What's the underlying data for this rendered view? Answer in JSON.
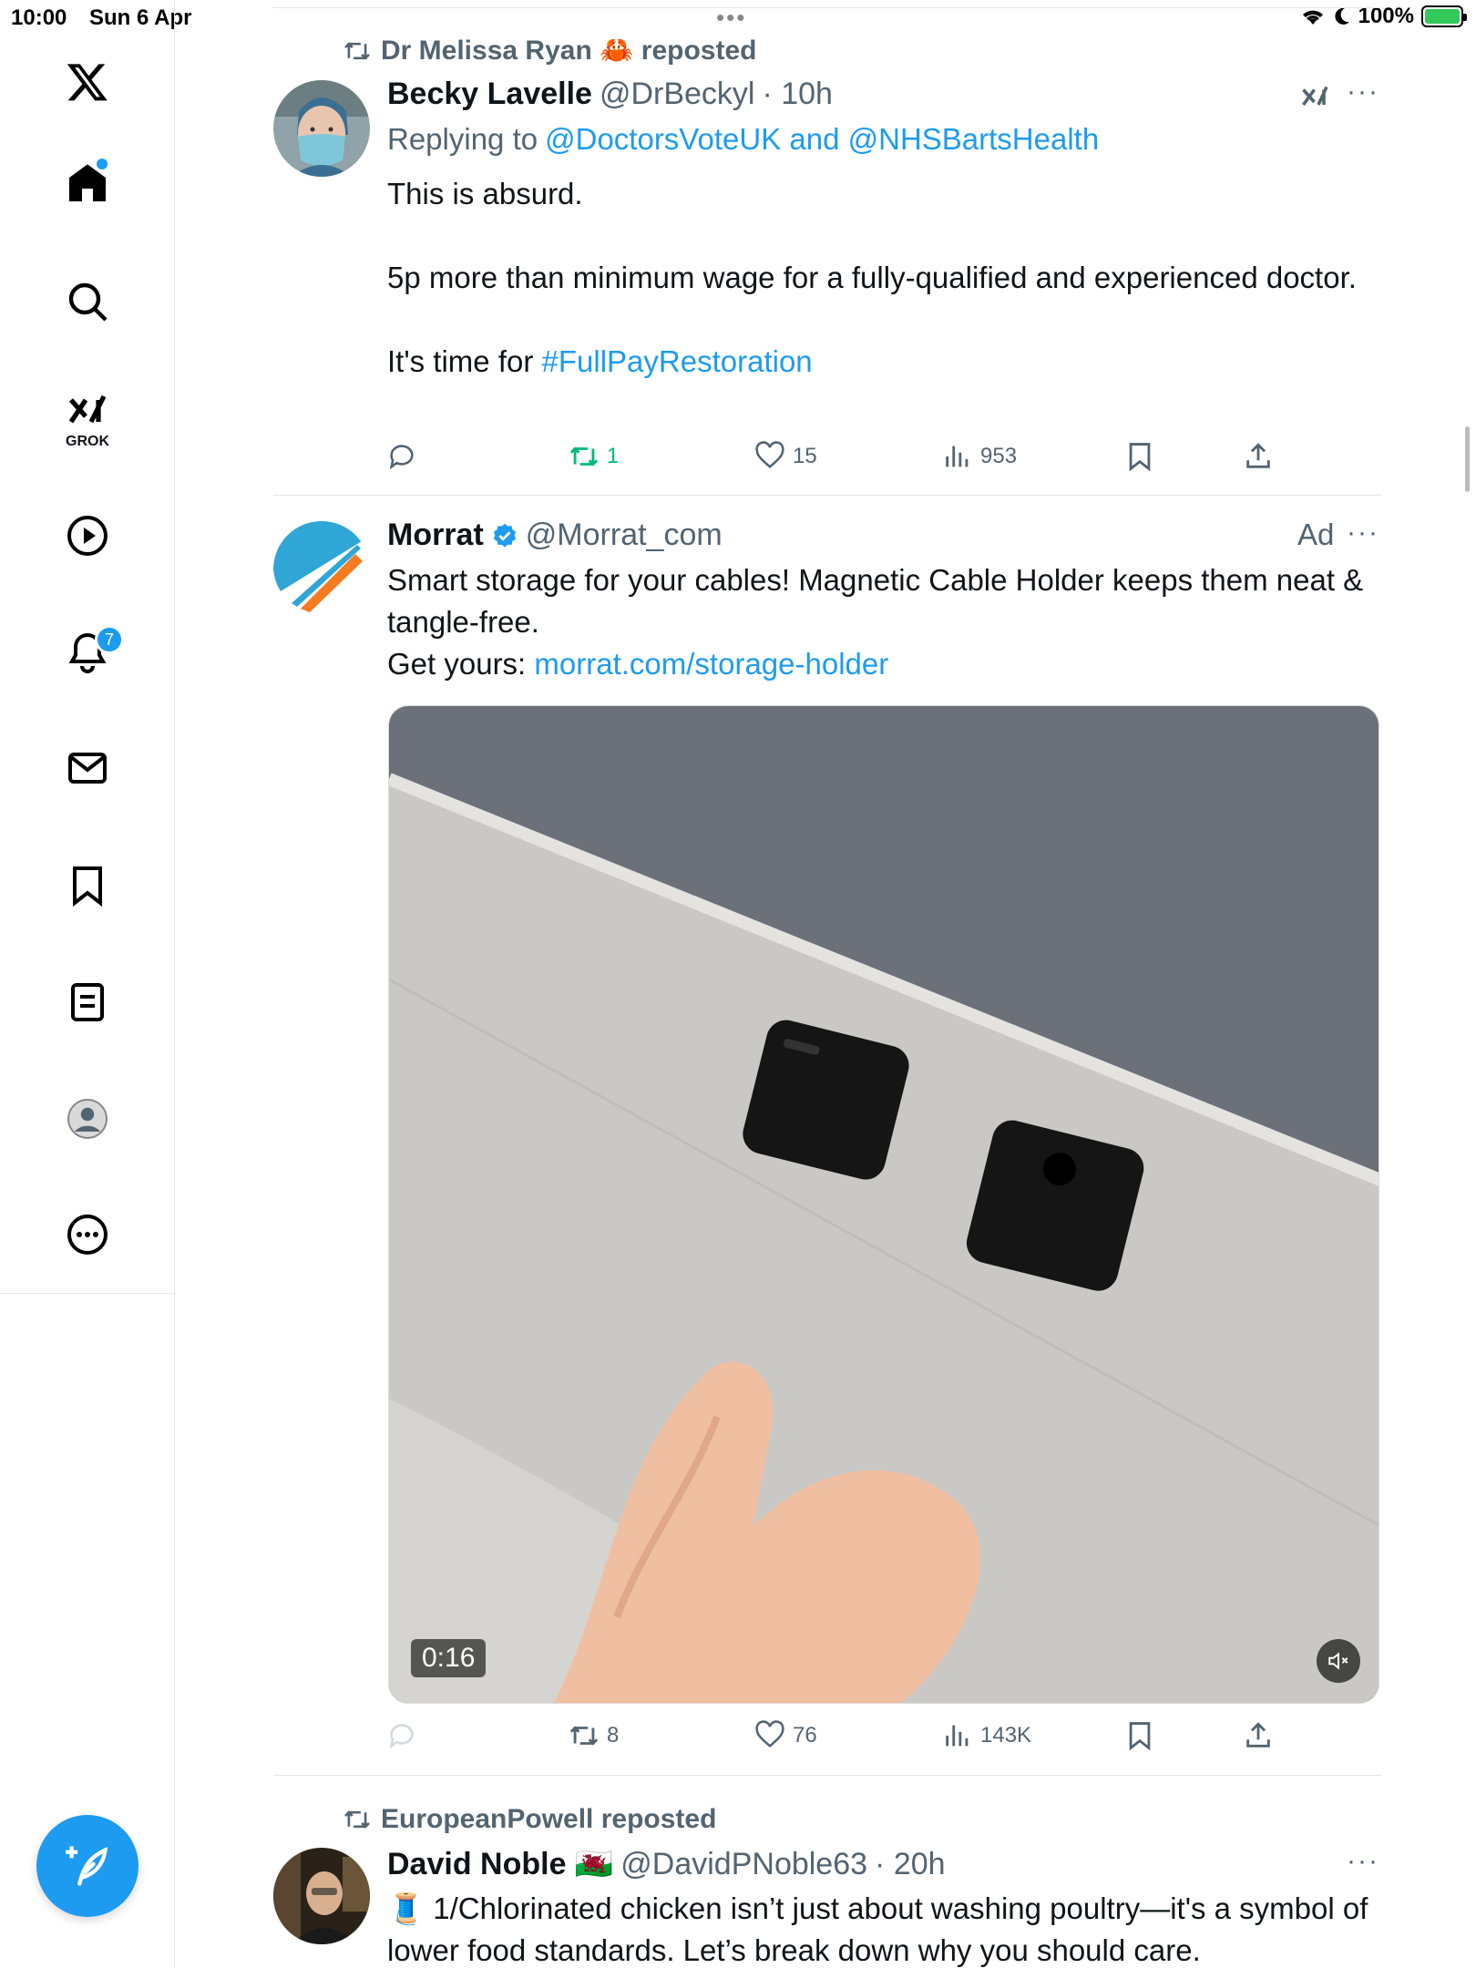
{
  "status_bar": {
    "time": "10:00",
    "date": "Sun 6 Apr",
    "battery": "100%"
  },
  "sidebar": {
    "grok_label": "GROK",
    "notifications_badge": "7"
  },
  "tweets": [
    {
      "repost_by": "Dr Melissa Ryan 🦀 reposted",
      "name": "Becky Lavelle",
      "handle": "@DrBeckyl",
      "time": "· 10h",
      "reply_prefix": "Replying to",
      "reply_to": "@DoctorsVoteUK and @NHSBartsHealth",
      "text_1": "This is absurd.",
      "text_2": "5p more than minimum wage for a fully-qualified and experienced doctor.",
      "text_3_prefix": "It's time for",
      "hashtag": "#FullPayRestoration",
      "reposts": "1",
      "likes": "15",
      "views": "953"
    },
    {
      "name": "Morrat",
      "handle": "@Morrat_com",
      "ad_label": "Ad",
      "text_1": "Smart storage for your cables! Magnetic Cable Holder keeps them neat & tangle-free.",
      "text_2_prefix": "Get yours:",
      "link": "morrat.com/storage-holder",
      "video_time": "0:16",
      "reposts": "8",
      "likes": "76",
      "views": "143K"
    },
    {
      "repost_by": "EuropeanPowell reposted",
      "name": "David Noble 🏴󠁧󠁢󠁷󠁬󠁳󠁿",
      "handle": "@DavidPNoble63",
      "time": "· 20h",
      "text_1": "🧵 1/Chlorinated chicken isn’t just about washing poultry—it's a symbol of lower food standards. Let’s break down why you should care."
    }
  ]
}
